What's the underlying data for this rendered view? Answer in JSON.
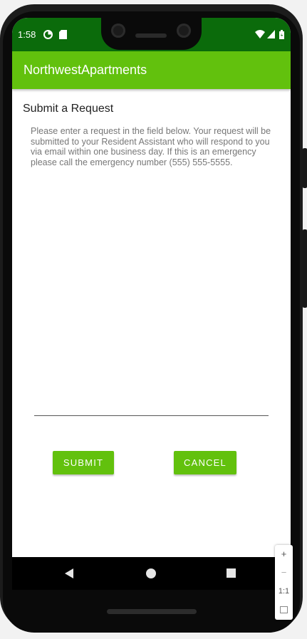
{
  "status_bar": {
    "time": "1:58",
    "left_icons": [
      "data-saver-icon",
      "sd-card-icon"
    ],
    "right_icons": [
      "wifi-icon",
      "cell-signal-icon",
      "battery-icon"
    ]
  },
  "app_bar": {
    "title": "NorthwestApartments",
    "color": "#62c10d",
    "status_color": "#0b6b0b"
  },
  "form": {
    "heading": "Submit a Request",
    "instructions": "Please enter a request in the field below. Your request will be submitted to your Resident Assistant who will respond to you via email within one business day. If this is an emergency please call the emergency number (555) 555-5555.",
    "request_value": "",
    "request_placeholder": "",
    "submit_label": "SUBMIT",
    "cancel_label": "CANCEL"
  },
  "nav_bar": {
    "icons": [
      "back-icon",
      "home-icon",
      "recents-icon"
    ]
  },
  "emulator_zoom": {
    "zoom_in": "+",
    "zoom_out": "−",
    "actual_size": "1:1",
    "fit_icon": "fit-screen-icon"
  }
}
